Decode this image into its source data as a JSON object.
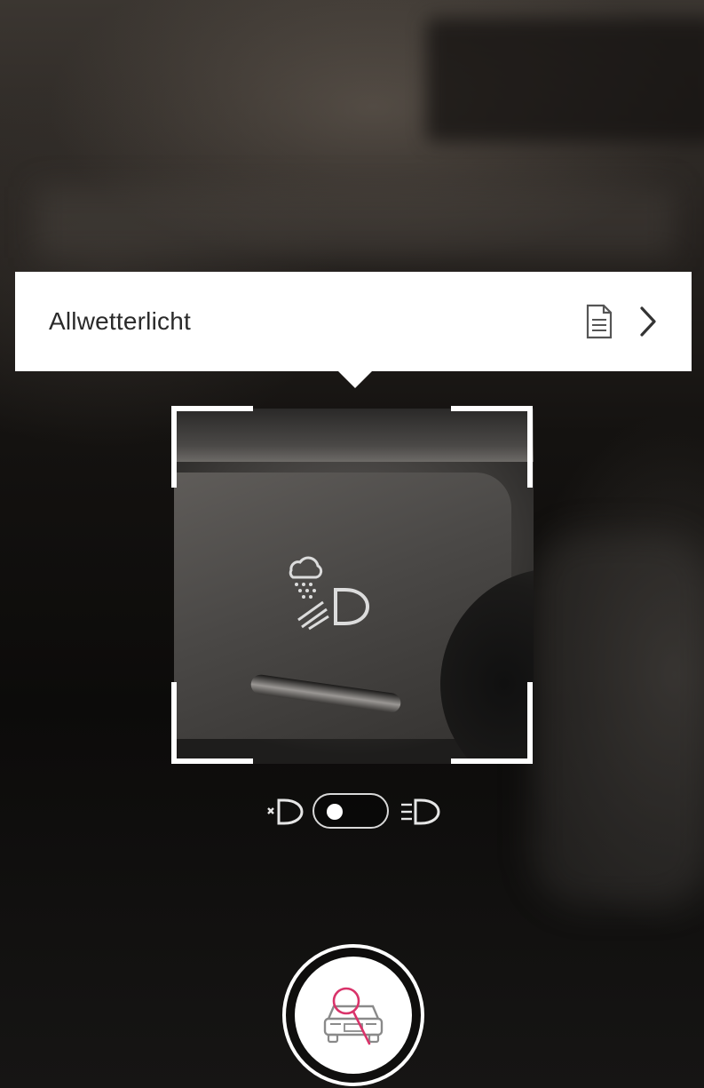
{
  "card": {
    "title": "Allwetterlicht",
    "document_icon": "document-icon",
    "chevron_icon": "chevron-right-icon"
  },
  "preview": {
    "symbol_icon": "all-weather-light-icon"
  },
  "light_toggle": {
    "off_icon": "headlight-off-icon",
    "on_icon": "headlight-on-icon",
    "state": "off"
  },
  "scan": {
    "icon": "car-search-icon",
    "accent_color": "#d9336a"
  }
}
